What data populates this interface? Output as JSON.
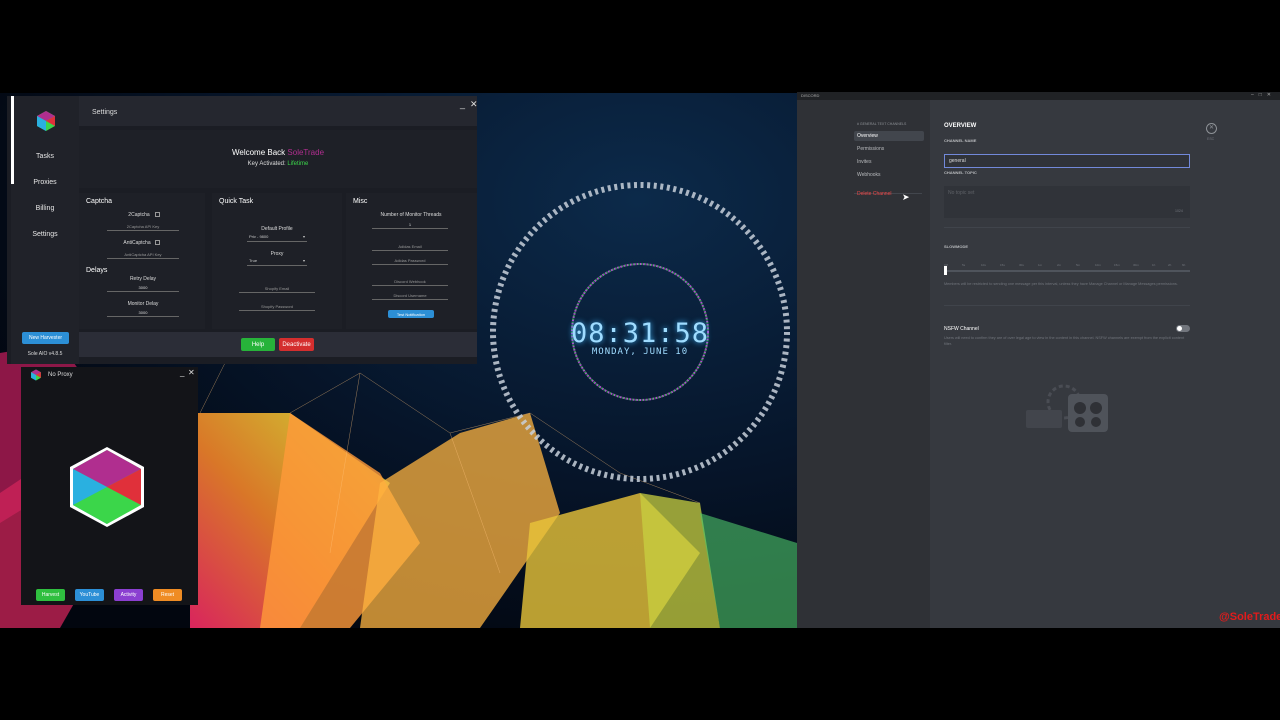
{
  "sole_aio": {
    "nav": [
      "Tasks",
      "Proxies",
      "Billing",
      "Settings"
    ],
    "new_harvester": "New Harvester",
    "version": "Sole AIO v4.8.5",
    "window_title": "Settings",
    "welcome_prefix": "Welcome Back",
    "welcome_name": "SoleTrade",
    "key_label": "Key Activated:",
    "key_value": "Lifetime",
    "captcha": {
      "title": "Captcha",
      "two_captcha": "2Captcha",
      "two_captcha_key": "2Captcha API Key",
      "anti_captcha": "AntiCaptcha",
      "anti_captcha_key": "AntiCaptcha API Key"
    },
    "delays": {
      "title": "Delays",
      "retry_label": "Retry Delay",
      "retry_value": "3000",
      "monitor_label": "Monitor Delay",
      "monitor_value": "3000"
    },
    "quick_task": {
      "title": "Quick Task",
      "profile_label": "Default Profile",
      "profile_value": "Priv - 9800",
      "proxy_label": "Proxy",
      "proxy_value": "True",
      "shopify_email": "Shopify Email",
      "shopify_password": "Shopify Password"
    },
    "misc": {
      "title": "Misc",
      "threads_label": "Number of Monitor Threads",
      "threads_value": "1",
      "adidas_email": "Adidas Email",
      "adidas_password": "Adidas Password",
      "discord_webhook": "Discord Webhook",
      "discord_username": "Discord Username",
      "test_button": "Test Notification"
    },
    "help_button": "Help",
    "deactivate_button": "Deactivate"
  },
  "harvester": {
    "title": "No Proxy",
    "buttons": [
      {
        "label": "Harvest",
        "color": "#2fbf3f"
      },
      {
        "label": "YouTube",
        "color": "#2c8fd6"
      },
      {
        "label": "Activity",
        "color": "#8b3fd1"
      },
      {
        "label": "Reset",
        "color": "#ef8c24"
      }
    ]
  },
  "clock": {
    "time": "08:31:58",
    "date": "MONDAY, JUNE 10"
  },
  "discord": {
    "app_title": "DISCORD",
    "category": "# GENERAL TEXT CHANNELS",
    "nav": [
      "Overview",
      "Permissions",
      "Invites",
      "Webhooks"
    ],
    "delete_channel": "Delete Channel",
    "heading": "OVERVIEW",
    "channel_name_label": "CHANNEL NAME",
    "channel_name_value": "general",
    "channel_topic_label": "CHANNEL TOPIC",
    "topic_placeholder": "No topic set",
    "topic_count": "1024",
    "slowmode_label": "SLOWMODE",
    "slowmode_ticks": [
      "Off",
      "5s",
      "10s",
      "15s",
      "30s",
      "1m",
      "2m",
      "5m",
      "10m",
      "15m",
      "30m",
      "1h",
      "2h",
      "6h"
    ],
    "slowmode_help": "Members will be restricted to sending one message per this interval, unless they have Manage Channel or Manage Messages permissions.",
    "nsfw_label": "NSFW Channel",
    "nsfw_help": "Users will need to confirm they are of over legal age to view in the content in this channel. NSFW channels are exempt from the explicit content filter.",
    "esc_label": "ESC"
  },
  "watermark": "@SoleTrade"
}
